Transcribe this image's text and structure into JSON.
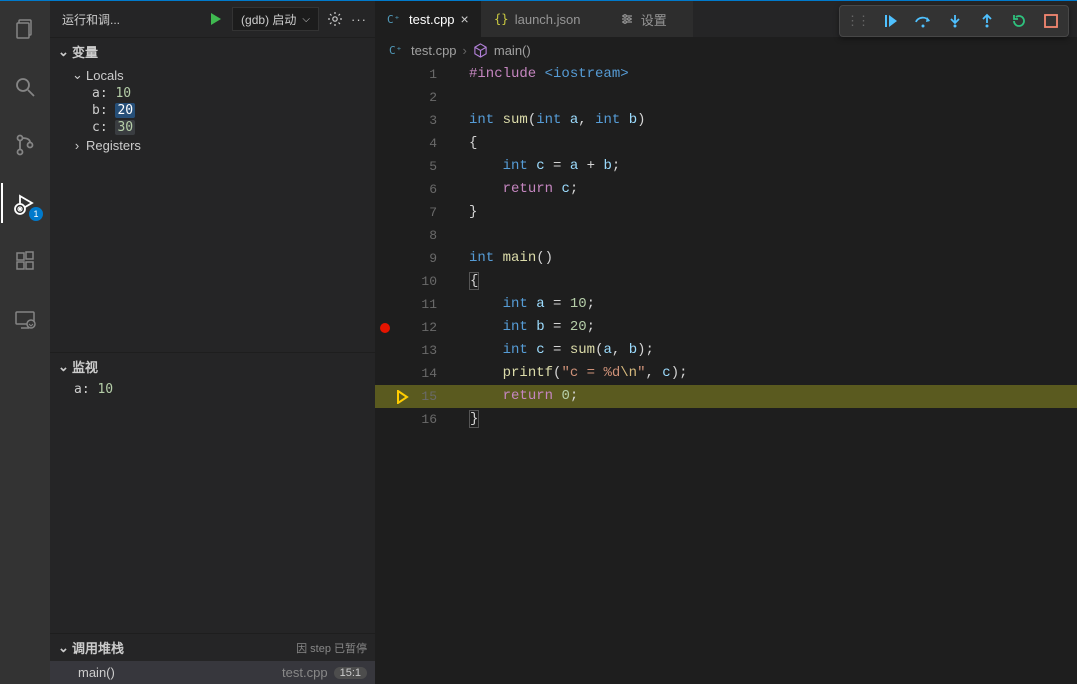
{
  "sidebar": {
    "title": "运行和调...",
    "launch_config": "(gdb) 启动",
    "sections": {
      "variables": {
        "label": "变量"
      },
      "locals": {
        "label": "Locals",
        "vars": [
          {
            "name": "a",
            "value": "10"
          },
          {
            "name": "b",
            "value": "20"
          },
          {
            "name": "c",
            "value": "30"
          }
        ]
      },
      "registers": {
        "label": "Registers"
      },
      "watch": {
        "label": "监视",
        "items": [
          {
            "expr": "a",
            "value": "10"
          }
        ]
      },
      "callstack": {
        "label": "调用堆栈",
        "status": "因 step 已暂停",
        "frames": [
          {
            "func": "main()",
            "file": "test.cpp",
            "line": "15:1"
          }
        ]
      }
    }
  },
  "tabs": [
    {
      "label": "test.cpp",
      "active": true,
      "icon": "cpp"
    },
    {
      "label": "launch.json",
      "active": false,
      "icon": "json"
    },
    {
      "label": "设置",
      "active": false,
      "icon": "settings"
    }
  ],
  "breadcrumb": {
    "file": "test.cpp",
    "symbol": "main()"
  },
  "debug_toolbar": {
    "badge": "1"
  },
  "code": {
    "filename": "test.cpp",
    "breakpoint_line": 12,
    "current_line": 15,
    "lines": {
      "1": {
        "include_kw": "#include",
        "include_target": "<iostream>"
      },
      "2": {},
      "3": {
        "ret_type": "int",
        "fname": "sum",
        "p1t": "int",
        "p1n": "a",
        "p2t": "int",
        "p2n": "b"
      },
      "4": {
        "brace": "{"
      },
      "5": {
        "decl_type": "int",
        "decl_name": "c",
        "assign_lhs": "a",
        "assign_rhs": "b"
      },
      "6": {
        "ret_kw": "return",
        "ret_var": "c"
      },
      "7": {
        "brace": "}"
      },
      "8": {},
      "9": {
        "ret_type": "int",
        "fname": "main"
      },
      "10": {
        "brace": "{"
      },
      "11": {
        "decl_type": "int",
        "decl_name": "a",
        "value": "10"
      },
      "12": {
        "decl_type": "int",
        "decl_name": "b",
        "value": "20"
      },
      "13": {
        "decl_type": "int",
        "decl_name": "c",
        "call": "sum",
        "arg1": "a",
        "arg2": "b"
      },
      "14": {
        "call": "printf",
        "fmt_a": "\"c = %d",
        "fmt_esc": "\\n",
        "fmt_b": "\"",
        "arg": "c"
      },
      "15": {
        "ret_kw": "return",
        "ret_num": "0"
      },
      "16": {
        "brace": "}"
      }
    }
  }
}
